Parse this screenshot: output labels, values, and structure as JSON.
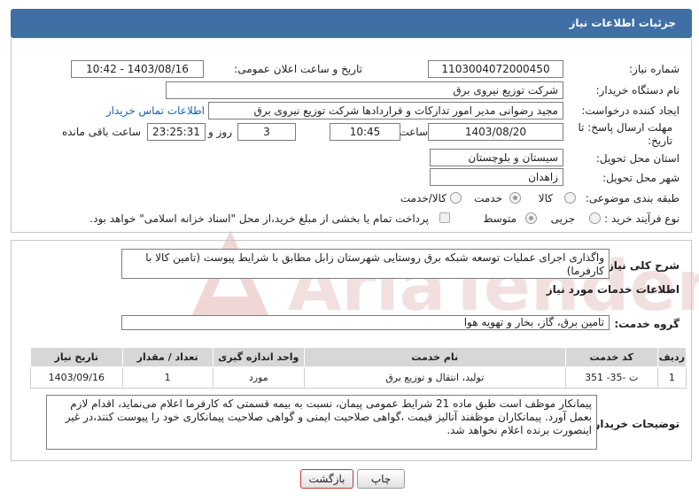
{
  "header": {
    "title": "جزئیات اطلاعات نیاز"
  },
  "form": {
    "need_number_label": "شماره نیاز:",
    "need_number": "1103004072000450",
    "announce_label": "تاریخ و ساعت اعلان عمومی:",
    "announce_value": "1403/08/16 - 10:42",
    "buyer_org_label": "نام دستگاه خریدار:",
    "buyer_org": "شرکت توزیع نیروی برق",
    "requester_label": "ایجاد کننده درخواست:",
    "requester": "مجید  رضوانی مدیر امور تدارکات و قراردادها شرکت توزیع نیروی برق",
    "contact_link": "اطلاعات تماس خریدار",
    "deadline_label": "مهلت ارسال پاسخ: تا تاریخ:",
    "deadline_date": "1403/08/20",
    "time_label": "ساعت",
    "deadline_time": "10:45",
    "days_value": "3",
    "days_label": "روز و",
    "remaining_time": "23:25:31",
    "remaining_label": "ساعت باقی مانده",
    "province_label": "استان محل تحویل:",
    "province": "سیستان و بلوچستان",
    "city_label": "شهر محل تحویل:",
    "city": "زاهدان",
    "category_label": "طبقه بندی موضوعی:",
    "category_options": [
      "کالا",
      "خدمت",
      "کالا/خدمت"
    ],
    "process_label": "نوع فرآیند خرید :",
    "process_options": [
      "جزیی",
      "متوسط"
    ],
    "payment_note": "پرداخت تمام یا بخشی از مبلغ خرید،از محل \"اسناد خزانه اسلامی\" خواهد بود."
  },
  "details": {
    "summary_label": "شرح کلی نیاز:",
    "summary": "واگذاری اجرای عملیات توسعه شبکه برق روستایی شهرستان زابل مطابق با شرایط پیوست (تامین کالا با کارفرما)",
    "services_title": "اطلاعات خدمات مورد نیاز",
    "service_group_label": "گروه خدمت:",
    "service_group": "تامین برق، گاز، بخار و تهویه هوا",
    "table": {
      "headers": [
        "ردیف",
        "کد خدمت",
        "نام خدمت",
        "واحد اندازه گیری",
        "تعداد / مقدار",
        "تاریخ نیاز"
      ],
      "rows": [
        [
          "1",
          "ت -35- 351",
          "تولید، انتقال و توزیع برق",
          "مورد",
          "1",
          "1403/09/16"
        ]
      ]
    },
    "buyer_notes_label": "توضیحات خریدار:",
    "buyer_notes": "پیمانکار موظف است طبق ماده 21 شرایط عمومی پیمان، نسبت به بیمه قسمتی که کارفرما اعلام می‌نماید، اقدام لازم بعمل آورد. پیمانکاران موظفند آنالیز قیمت ،گواهی صلاحیت ایمنی و گواهی صلاحیت پیمانکاری خود را پیوست کنند،در غیر اینصورت برنده اعلام نخواهد شد."
  },
  "buttons": {
    "print": "چاپ",
    "back": "بازگشت"
  },
  "watermark": "AriaTender.neT",
  "colors": {
    "header": "#3f6fa4",
    "watermark": "#e8c7c7"
  }
}
